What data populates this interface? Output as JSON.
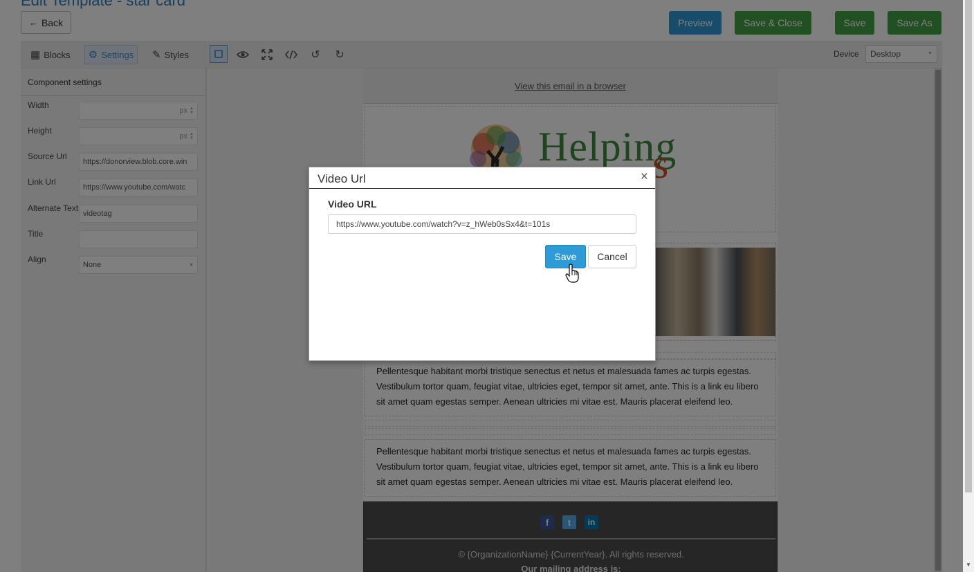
{
  "page": {
    "title": "Edit Template - star card",
    "back_label": "Back"
  },
  "top_actions": {
    "preview": "Preview",
    "save_close": "Save & Close",
    "save": "Save",
    "save_as": "Save As"
  },
  "panel": {
    "tabs": [
      {
        "label": "Blocks",
        "icon": "blocks-icon"
      },
      {
        "label": "Settings",
        "icon": "gear-icon"
      },
      {
        "label": "Styles",
        "icon": "brush-icon"
      }
    ],
    "active_tab": "Settings",
    "header": "Component settings",
    "fields": [
      {
        "label": "Width",
        "value": "",
        "unit": "px"
      },
      {
        "label": "Height",
        "value": "",
        "unit": "px"
      },
      {
        "label": "Source Url",
        "value": "https://donorview.blob.core.win"
      },
      {
        "label": "Link Url",
        "value": "https://www.youtube.com/watc"
      },
      {
        "label": "Alternate Text",
        "value": "videotag"
      },
      {
        "label": "Title",
        "value": ""
      },
      {
        "label": "Align",
        "value": "None"
      }
    ]
  },
  "toolbar": {
    "tools": [
      "select-icon",
      "eye-icon",
      "fullscreen-icon",
      "code-icon",
      "undo-icon",
      "redo-icon"
    ],
    "device_label": "Device",
    "device_value": "Desktop"
  },
  "email": {
    "view_browser": "View this email in a browser",
    "logo_text": "Helping",
    "logo_partial": "s",
    "paragraph": "Pellentesque habitant morbi tristique senectus et netus et malesuada fames ac turpis egestas. Vestibulum tortor quam, feugiat vitae, ultricies eget, tempor sit amet, ante. This is a link eu libero sit amet quam egestas semper. Aenean ultricies mi vitae est. Mauris placerat eleifend leo.",
    "social": [
      "facebook-icon",
      "twitter-icon",
      "linkedin-icon"
    ],
    "copyright": "© {OrganizationName} {CurrentYear}. All rights reserved.",
    "mailing": "Our mailing address is:"
  },
  "modal": {
    "title": "Video Url",
    "close": "×",
    "label": "Video URL",
    "url": "https://www.youtube.com/watch?v=z_hWeb0sSx4&t=101s",
    "save": "Save",
    "cancel": "Cancel"
  },
  "colors": {
    "primary_blue": "#2e9bd6",
    "action_green": "#43a047",
    "overlay": "rgba(0,0,0,0.5)"
  }
}
